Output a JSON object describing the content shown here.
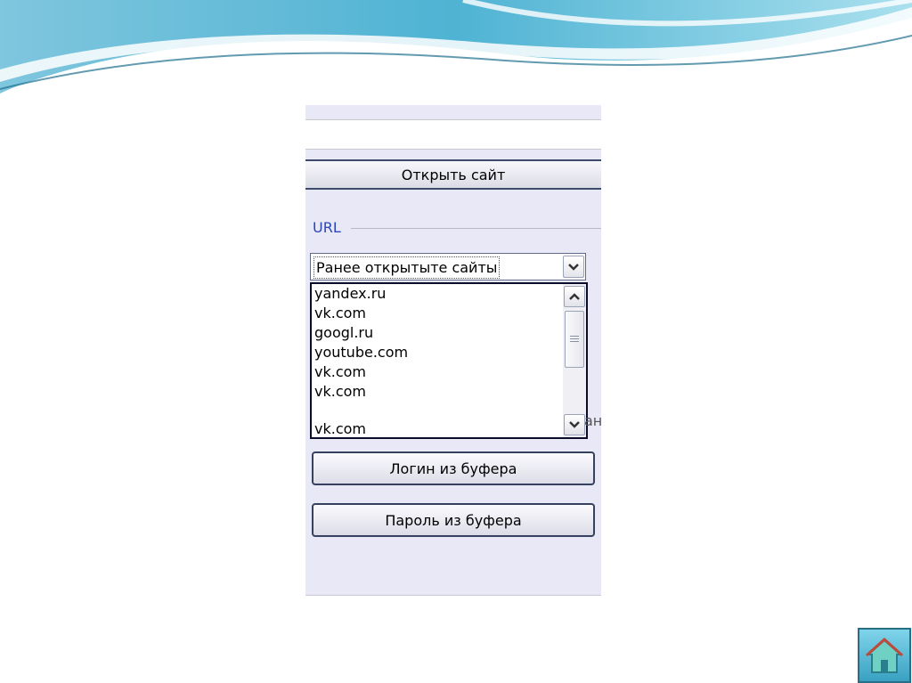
{
  "panel": {
    "open_site_label": "Открыть сайт",
    "url_group_label": "URL",
    "combo_value": "Ранее открытыте сайты",
    "clipped_text": "ан",
    "history": [
      "yandex.ru",
      "vk.com",
      "googl.ru",
      "youtube.com",
      "vk.com",
      "vk.com",
      "",
      "vk.com"
    ],
    "login_button_label": "Логин из буфера",
    "password_button_label": "Пароль из буфера"
  },
  "colors": {
    "panel_bg": "#e8e8f7",
    "legend_blue": "#2b46b8",
    "wave_teal": "#5bbcd6"
  },
  "icons": {
    "combo_arrow": "chevron-down-icon",
    "scroll_up": "chevron-up-icon",
    "scroll_down": "chevron-down-icon",
    "home": "home-icon"
  }
}
